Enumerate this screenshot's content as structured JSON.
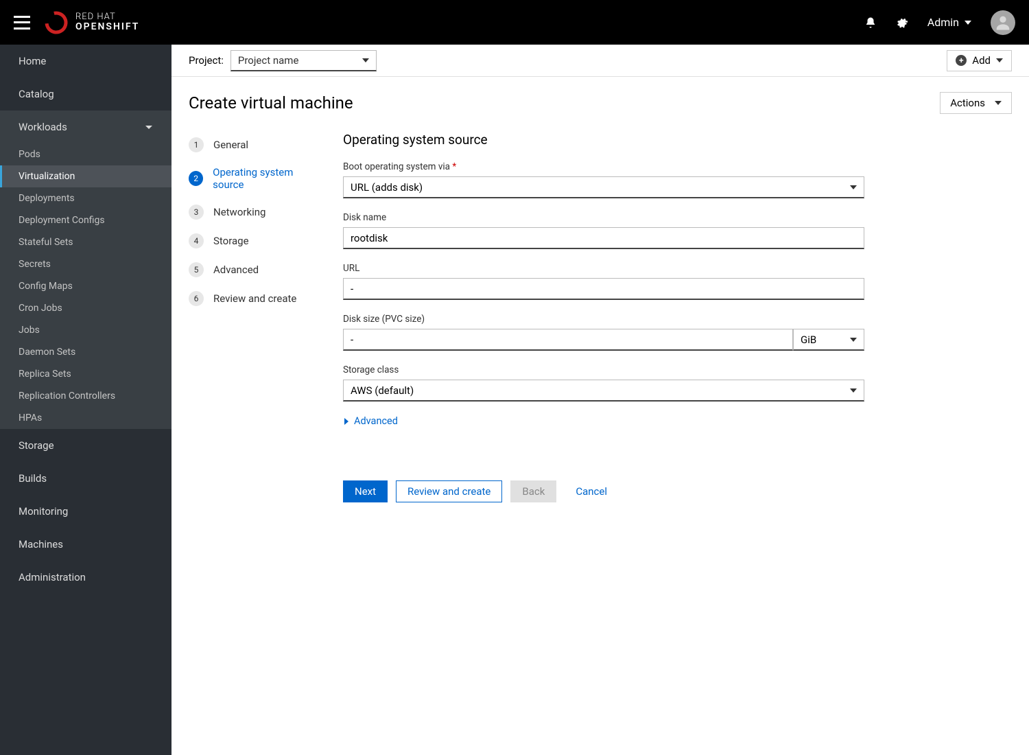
{
  "header": {
    "brand_line1": "RED HAT",
    "brand_line2": "OPENSHIFT",
    "user_label": "Admin"
  },
  "sidebar": {
    "home": "Home",
    "catalog": "Catalog",
    "workloads": {
      "label": "Workloads",
      "items": [
        "Pods",
        "Virtualization",
        "Deployments",
        "Deployment Configs",
        "Stateful Sets",
        "Secrets",
        "Config Maps",
        "Cron Jobs",
        "Jobs",
        "Daemon Sets",
        "Replica Sets",
        "Replication Controllers",
        "HPAs"
      ]
    },
    "storage": "Storage",
    "builds": "Builds",
    "monitoring": "Monitoring",
    "machines": "Machines",
    "administration": "Administration"
  },
  "toolbar": {
    "project_label": "Project:",
    "project_value": "Project name",
    "add_label": "Add"
  },
  "page": {
    "title": "Create virtual machine",
    "actions_label": "Actions"
  },
  "wizard": {
    "steps": [
      "General",
      "Operating system source",
      "Networking",
      "Storage",
      "Advanced",
      "Review and create"
    ],
    "active_index": 1
  },
  "form": {
    "heading": "Operating system source",
    "boot_via_label": "Boot operating system via",
    "boot_via_value": "URL (adds disk)",
    "disk_name_label": "Disk name",
    "disk_name_value": "rootdisk",
    "url_label": "URL",
    "url_value": "-",
    "disk_size_label": "Disk size (PVC size)",
    "disk_size_value": "-",
    "disk_size_unit": "GiB",
    "storage_class_label": "Storage class",
    "storage_class_value": "AWS (default)",
    "advanced_label": "Advanced"
  },
  "buttons": {
    "next": "Next",
    "review": "Review and create",
    "back": "Back",
    "cancel": "Cancel"
  }
}
